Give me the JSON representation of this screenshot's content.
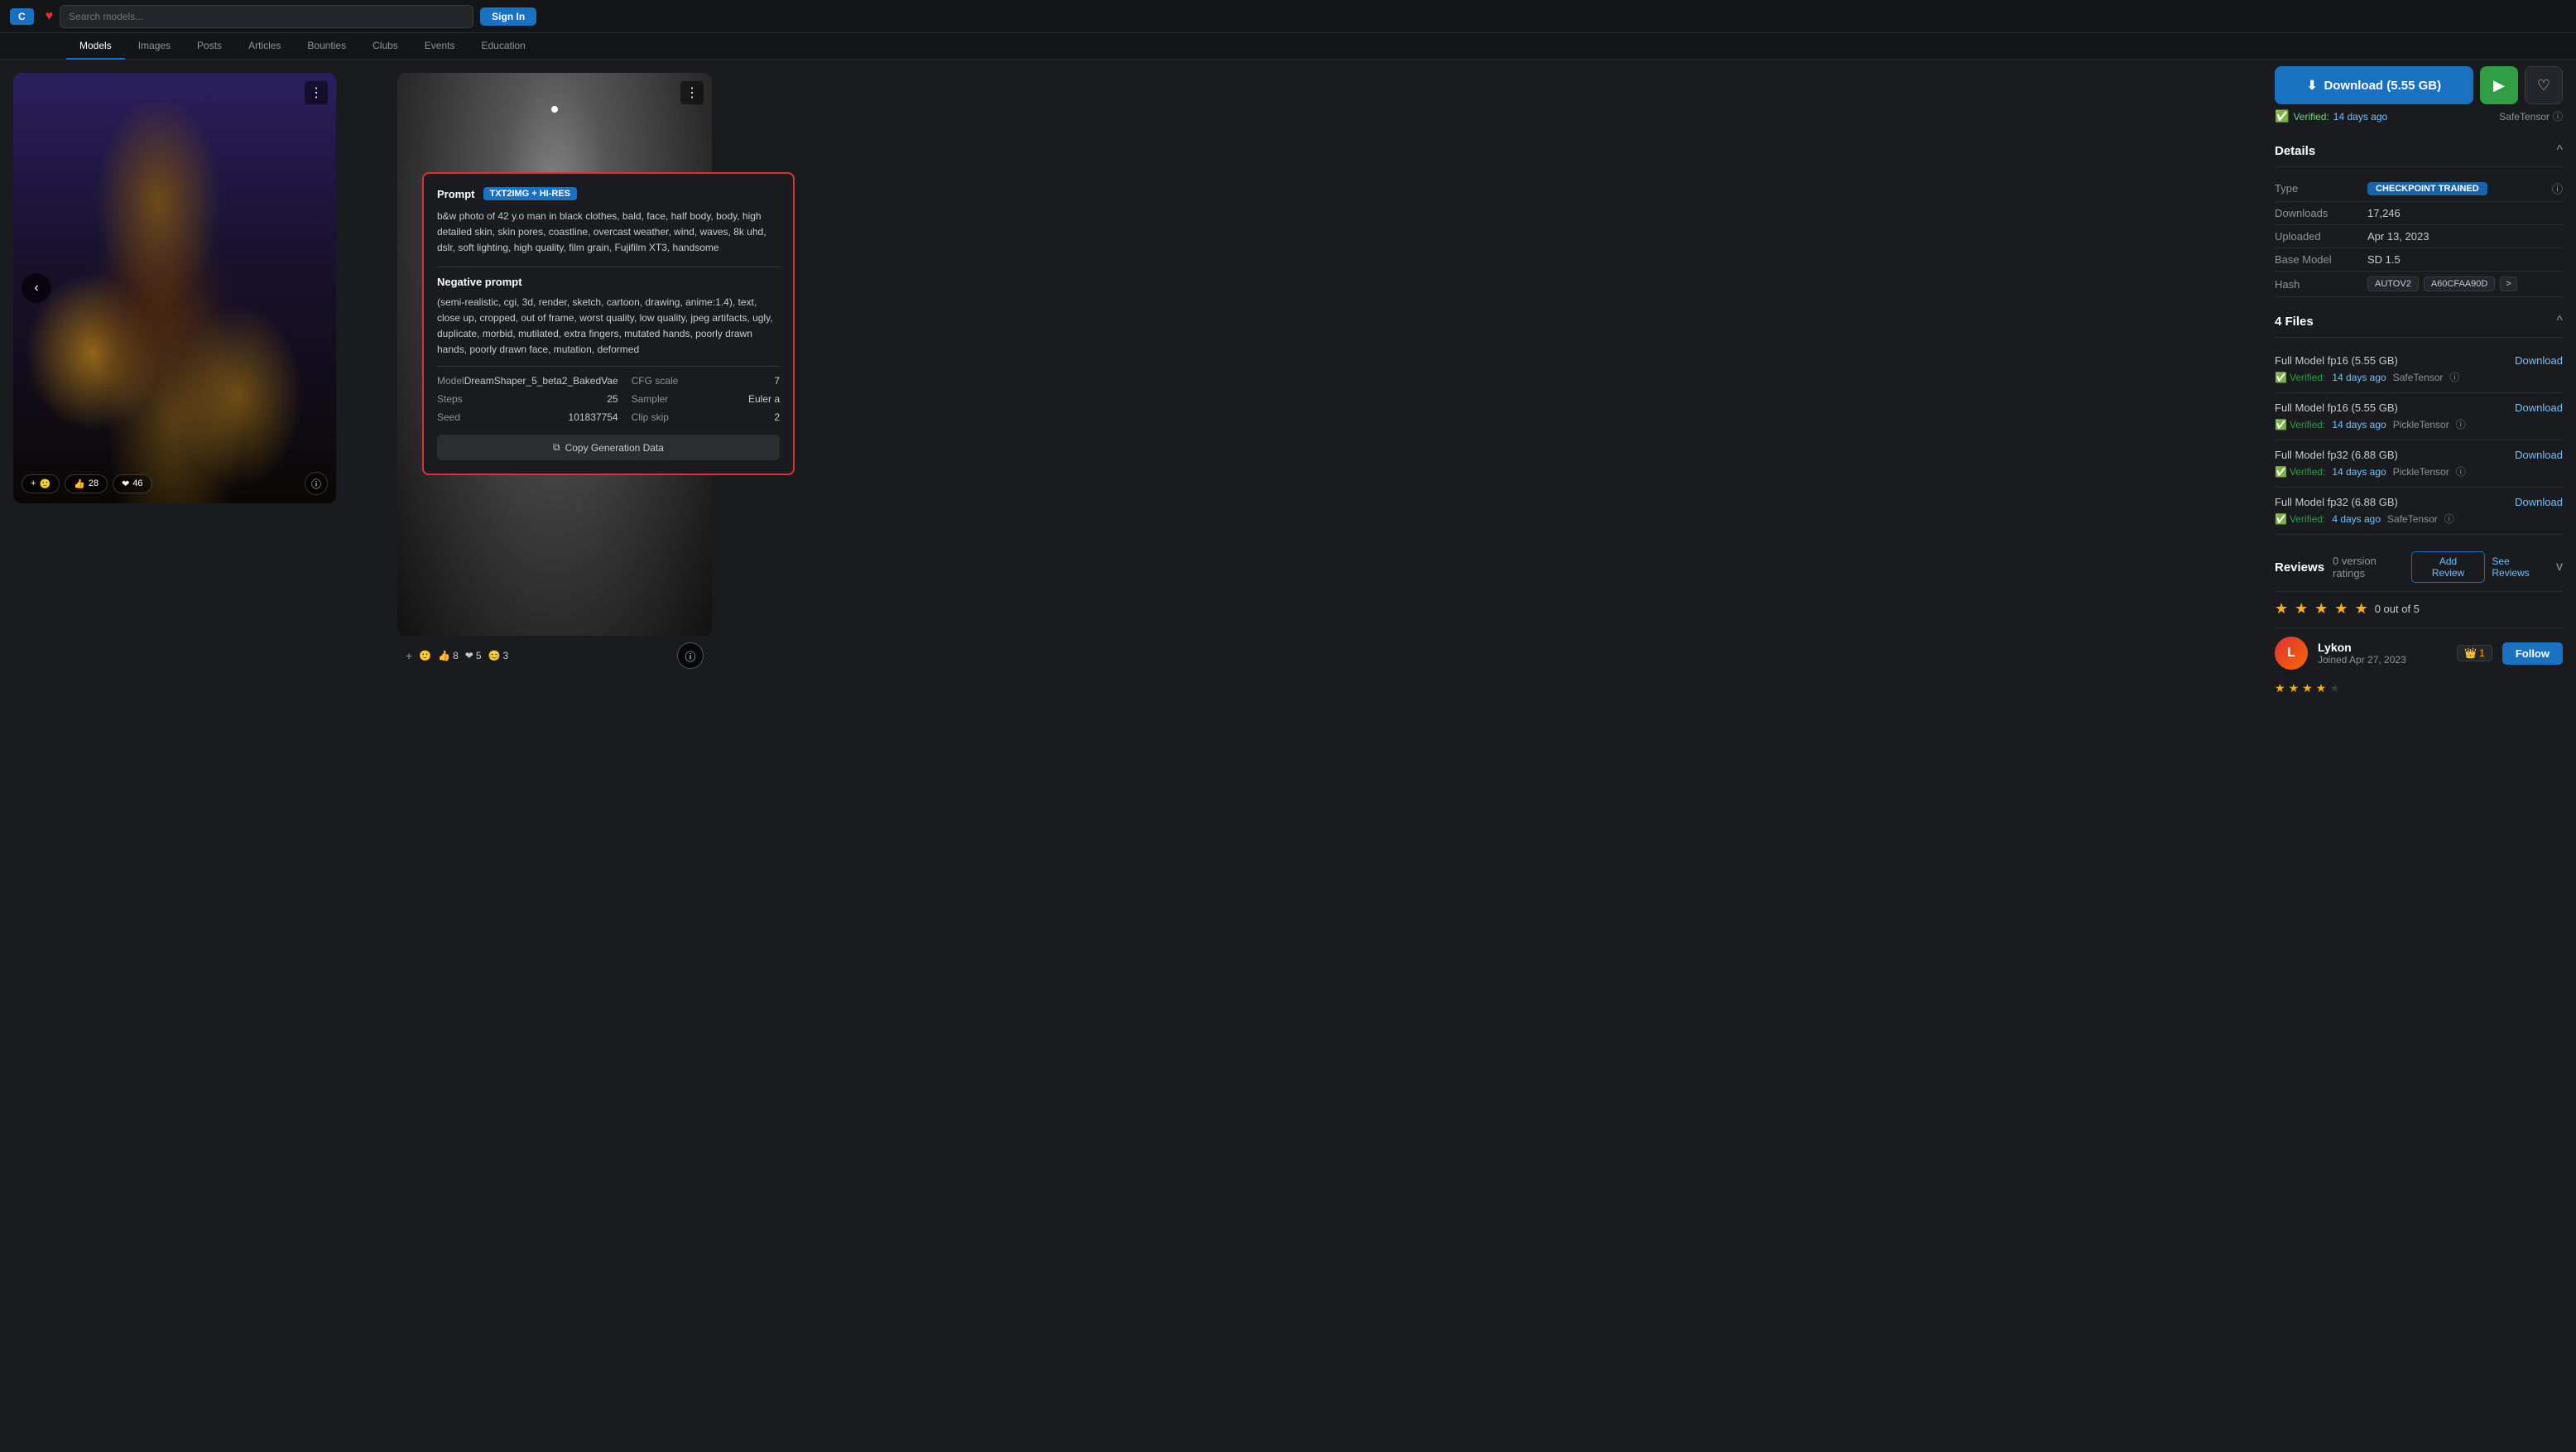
{
  "nav": {
    "logo": "C",
    "search_placeholder": "Search models...",
    "signin_label": "Sign In",
    "heart_icon": "♥"
  },
  "sub_nav": {
    "tabs": [
      "Models",
      "Images",
      "Posts",
      "Articles",
      "Bounties",
      "Clubs",
      "Events",
      "Education"
    ],
    "active": "Models"
  },
  "gallery": {
    "prev_btn_icon": "‹",
    "menu_icon": "⋮",
    "add_icon": "+",
    "smiley_icon": "🙂",
    "thumbs_icon": "👍",
    "thumbs_count": "28",
    "heart_icon": "❤",
    "heart_count": "46",
    "info_icon": "ⓘ"
  },
  "prompt_overlay": {
    "label": "Prompt",
    "badge": "TXT2IMG + HI-RES",
    "prompt_text": "b&w photo of 42 y.o man in black clothes, bald, face, half body, body, high detailed skin, skin pores, coastline, overcast weather, wind, waves, 8k uhd, dslr, soft lighting, high quality, film grain, Fujifilm XT3, handsome",
    "neg_label": "Negative prompt",
    "neg_text": "(semi-realistic, cgi, 3d, render, sketch, cartoon, drawing, anime:1.4), text, close up, cropped, out of frame, worst quality, low quality, jpeg artifacts, ugly, duplicate, morbid, mutilated, extra fingers, mutated hands, poorly drawn hands, poorly drawn face, mutation, deformed",
    "model_label": "Model",
    "model_val": "DreamShaper_5_beta2_BakedVae",
    "cfg_label": "CFG scale",
    "cfg_val": "7",
    "steps_label": "Steps",
    "steps_val": "25",
    "sampler_label": "Sampler",
    "sampler_val": "Euler a",
    "seed_label": "Seed",
    "seed_val": "101837754",
    "clip_label": "Clip skip",
    "clip_val": "2",
    "copy_btn": "Copy Generation Data",
    "copy_icon": "⧉"
  },
  "preview_footer": {
    "add_icon": "+",
    "smiley_icon": "🙂",
    "thumbs_icon": "👍",
    "thumbs_count": "8",
    "heart_icon": "❤",
    "heart_count": "5",
    "smile2_icon": "😊",
    "smile2_count": "3",
    "info_icon": "ⓘ"
  },
  "sidebar": {
    "download_label": "Download (5.55 GB)",
    "download_icon": "⬇",
    "play_icon": "▶",
    "heart_icon": "♡",
    "verified_label": "Verified:",
    "verified_date": "14 days ago",
    "safe_tensor_label": "SafeTensor",
    "info_icon": "ⓘ",
    "details": {
      "title": "Details",
      "collapse_icon": "^",
      "rows": [
        {
          "key": "Type",
          "value": "CHECKPOINT TRAINED",
          "type": "badge",
          "info": true
        },
        {
          "key": "Downloads",
          "value": "17,246",
          "type": "text",
          "info": false
        },
        {
          "key": "Uploaded",
          "value": "Apr 13, 2023",
          "type": "text",
          "info": false
        },
        {
          "key": "Base Model",
          "value": "SD 1.5",
          "type": "text",
          "info": false
        },
        {
          "key": "Hash",
          "value": "",
          "type": "hash",
          "info": false,
          "hash1": "AUTOV2",
          "hash2": "A60CFAA90D",
          "hash_more": ">"
        }
      ]
    },
    "files": {
      "title": "4 Files",
      "collapse_icon": "^",
      "items": [
        {
          "name": "Full Model fp16 (5.55 GB)",
          "download": "Download",
          "verified_text": "Verified:",
          "verified_date": "14 days ago",
          "tensor_type": "SafeTensor",
          "info_icon": "ⓘ"
        },
        {
          "name": "Full Model fp16 (5.55 GB)",
          "download": "Download",
          "verified_text": "Verified:",
          "verified_date": "14 days ago",
          "tensor_type": "PickleTensor",
          "info_icon": "ⓘ"
        },
        {
          "name": "Full Model fp32 (6.88 GB)",
          "download": "Download",
          "verified_text": "Verified:",
          "verified_date": "14 days ago",
          "tensor_type": "PickleTensor",
          "info_icon": "ⓘ"
        },
        {
          "name": "Full Model fp32 (6.88 GB)",
          "download": "Download",
          "verified_text": "Verified:",
          "verified_date": "4 days ago",
          "tensor_type": "SafeTensor",
          "info_icon": "ⓘ"
        }
      ]
    },
    "reviews": {
      "title": "Reviews",
      "count_label": "0 version ratings",
      "add_review": "Add Review",
      "see_reviews": "See Reviews",
      "collapse_icon": "v",
      "stars": [
        "★",
        "★",
        "★",
        "★",
        "★"
      ],
      "rating_text": "0 out of 5"
    },
    "user": {
      "name": "Lykon",
      "joined": "Joined Apr 27, 2023",
      "crown_icon": "👑",
      "crown_count": "1",
      "follow_label": "Follow",
      "avatar_letter": "L"
    }
  },
  "colors": {
    "accent_blue": "#1971c2",
    "accent_green": "#2f9e44",
    "accent_red": "#e03131",
    "accent_gold": "#fab005",
    "bg_dark": "#1a1b1e",
    "bg_darker": "#141517",
    "border": "#2c2d30"
  }
}
